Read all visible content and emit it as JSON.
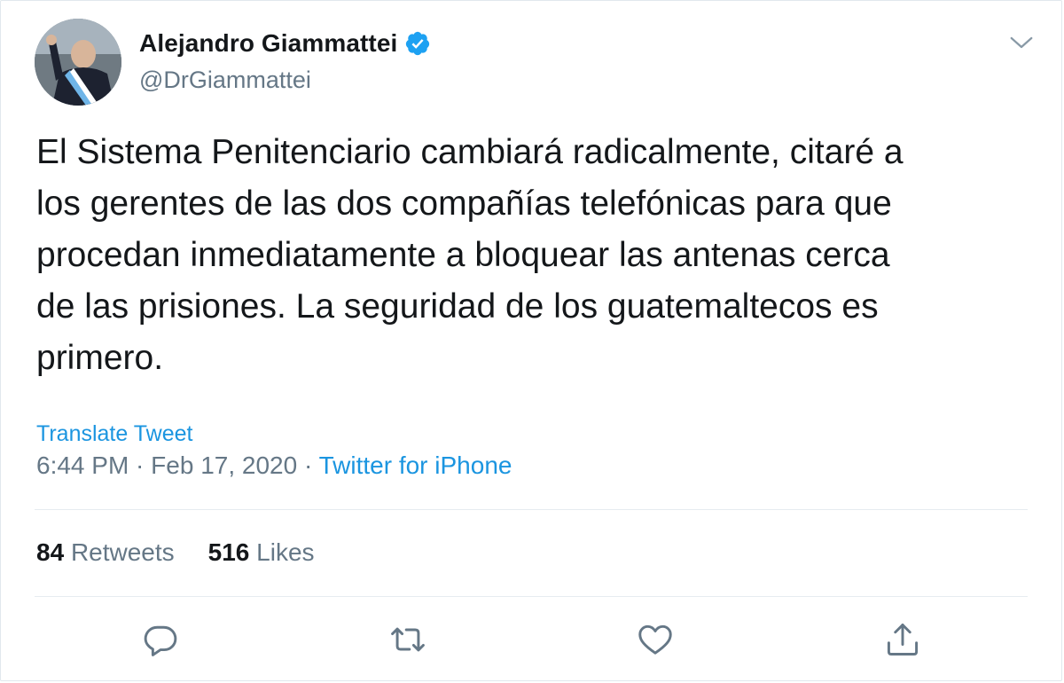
{
  "author": {
    "display_name": "Alejandro Giammattei",
    "handle": "@DrGiammattei",
    "verified": true,
    "avatar_icon": "profile-photo"
  },
  "tweet": {
    "text": "El Sistema Penitenciario cambiará radicalmente, citaré a\nlos gerentes de las dos compañías telefónicas para que\nprocedan inmediatamente a bloquear las antenas cerca\nde las prisiones. La seguridad de los guatemaltecos es\nprimero.",
    "translate_label": "Translate Tweet",
    "time": "6:44 PM",
    "separator": " · ",
    "date": "Feb 17, 2020",
    "source": "Twitter for iPhone"
  },
  "stats": {
    "retweets_count": "84",
    "retweets_label": "Retweets",
    "likes_count": "516",
    "likes_label": "Likes"
  },
  "actions": [
    {
      "icon": "reply-icon"
    },
    {
      "icon": "retweet-icon"
    },
    {
      "icon": "like-icon"
    },
    {
      "icon": "share-icon"
    }
  ],
  "colors": {
    "link": "#1b95e0",
    "verified": "#1da1f2",
    "secondary_text": "#657786",
    "primary_text": "#14171a",
    "icon": "#657786"
  }
}
